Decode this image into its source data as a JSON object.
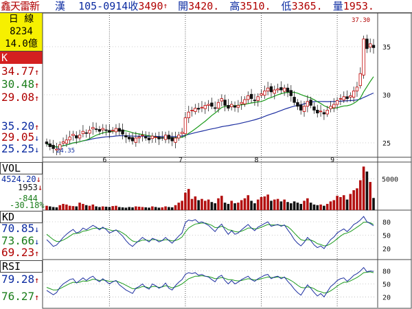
{
  "header": {
    "stock_name": "鑫天雷新",
    "kind": "漢",
    "date": "105-0914",
    "close_label": "收",
    "close_value": "3490",
    "close_arrow": "↑",
    "open_label": "開",
    "open_value": "3420.",
    "high_label": "高",
    "high_value": "3510.",
    "low_label": "低",
    "low_value": "3365.",
    "volume_label": "量",
    "volume_value": "1953."
  },
  "info_box": {
    "period": "日 線",
    "trade_count": "8234",
    "amount": "14.0億"
  },
  "k_panel": {
    "label": "K",
    "ma_values": [
      {
        "value": "34.77",
        "arrow": "↑",
        "color": "#b00000"
      },
      {
        "value": "30.48",
        "arrow": "↑",
        "color": "#1a7d1a"
      },
      {
        "value": "29.08",
        "arrow": "↑",
        "color": "#b00000"
      },
      {
        "value": "35.20",
        "arrow": "↑",
        "color": "#0a2aa0"
      },
      {
        "value": "29.05",
        "arrow": "↓",
        "color": "#b00000"
      },
      {
        "value": "25.25",
        "arrow": "↓",
        "color": "#0a2aa0"
      }
    ],
    "max_label": "37.30",
    "min_label": "24.35",
    "price_ticks": [
      "35",
      "30",
      "25"
    ],
    "month_labels": [
      "6",
      "7",
      "8",
      "9"
    ]
  },
  "vol_panel": {
    "label": "VOL",
    "value1": "4524.20",
    "value1_arrow": "↓",
    "value2": "1953",
    "value2_arrow": "↓",
    "diff": "-844",
    "diff_pct": "-30.18%",
    "tick": "5000"
  },
  "kd_panel": {
    "label": "KD",
    "values": [
      {
        "value": "70.85",
        "arrow": "↓",
        "color": "#0a2aa0"
      },
      {
        "value": "73.66",
        "arrow": "↓",
        "color": "#1a7d1a"
      },
      {
        "value": "69.23",
        "arrow": "↑",
        "color": "#b00000"
      }
    ],
    "ticks": [
      "80",
      "50",
      "20"
    ]
  },
  "rsi_panel": {
    "label": "RSI",
    "values": [
      {
        "value": "79.28",
        "arrow": "↑",
        "color": "#0a2aa0"
      },
      {
        "value": "76.27",
        "arrow": "↑",
        "color": "#1a7d1a"
      }
    ],
    "ticks": [
      "80",
      "50",
      "20"
    ]
  },
  "chart_data": {
    "type": "line",
    "ticks_price": [
      25,
      30,
      35
    ],
    "ylim": [
      23.5,
      38.5
    ],
    "months": [
      "6",
      "7",
      "8",
      "9"
    ],
    "close": [
      24.9,
      24.6,
      24.4,
      24.35,
      24.8,
      25.1,
      25.3,
      25.6,
      25.9,
      25.5,
      25.8,
      26.2,
      26.0,
      26.3,
      26.6,
      26.4,
      26.2,
      26.5,
      26.3,
      26.1,
      26.3,
      26.5,
      26.2,
      25.9,
      25.6,
      25.4,
      25.2,
      25.5,
      25.6,
      25.8,
      25.5,
      25.3,
      25.7,
      25.6,
      25.4,
      25.5,
      25.8,
      25.4,
      25.2,
      25.5,
      25.8,
      26.1,
      27.6,
      28.2,
      28.4,
      28.6,
      28.5,
      28.7,
      28.9,
      29.0,
      28.8,
      28.6,
      29.2,
      29.6,
      28.9,
      28.6,
      29.0,
      28.7,
      28.9,
      29.2,
      29.5,
      29.9,
      29.6,
      29.4,
      29.8,
      30.1,
      30.4,
      30.7,
      30.3,
      30.5,
      30.6,
      30.5,
      30.7,
      30.3,
      29.9,
      29.2,
      28.8,
      28.4,
      28.8,
      29.3,
      28.9,
      28.4,
      28.1,
      28.3,
      28.0,
      28.4,
      28.8,
      29.0,
      29.4,
      29.6,
      29.8,
      29.6,
      29.9,
      30.4,
      30.8,
      32.2,
      35.8,
      34.8,
      35.3,
      34.9
    ],
    "kd_k": [
      40,
      33,
      25,
      28,
      36,
      45,
      52,
      58,
      63,
      55,
      58,
      66,
      62,
      67,
      72,
      68,
      62,
      68,
      63,
      55,
      58,
      62,
      55,
      48,
      38,
      30,
      25,
      32,
      38,
      45,
      40,
      35,
      43,
      40,
      35,
      38,
      45,
      38,
      32,
      40,
      48,
      55,
      78,
      84,
      82,
      85,
      78,
      80,
      76,
      72,
      65,
      58,
      68,
      75,
      62,
      52,
      60,
      52,
      55,
      62,
      68,
      74,
      66,
      60,
      68,
      72,
      76,
      80,
      70,
      72,
      74,
      70,
      73,
      62,
      52,
      40,
      32,
      26,
      34,
      45,
      38,
      28,
      22,
      26,
      20,
      30,
      40,
      46,
      55,
      60,
      64,
      58,
      65,
      74,
      78,
      84,
      92,
      80,
      76,
      71
    ],
    "kd_d": [
      52,
      46,
      40,
      36,
      36,
      39,
      43,
      48,
      53,
      54,
      55,
      59,
      60,
      62,
      65,
      66,
      65,
      66,
      65,
      62,
      60,
      61,
      59,
      55,
      50,
      43,
      37,
      35,
      36,
      39,
      39,
      38,
      40,
      40,
      38,
      38,
      40,
      39,
      37,
      38,
      41,
      46,
      57,
      66,
      71,
      75,
      76,
      77,
      77,
      75,
      72,
      67,
      67,
      70,
      67,
      62,
      61,
      58,
      57,
      59,
      62,
      66,
      66,
      64,
      65,
      68,
      71,
      74,
      73,
      73,
      73,
      72,
      72,
      69,
      63,
      55,
      47,
      40,
      38,
      40,
      39,
      36,
      31,
      29,
      26,
      27,
      31,
      36,
      42,
      48,
      53,
      55,
      58,
      63,
      68,
      73,
      79,
      79,
      78,
      74
    ],
    "rsi_fast": [
      35,
      30,
      25,
      30,
      42,
      50,
      55,
      60,
      62,
      52,
      58,
      64,
      58,
      64,
      68,
      60,
      55,
      62,
      56,
      50,
      55,
      58,
      48,
      42,
      36,
      32,
      28,
      40,
      44,
      50,
      42,
      38,
      50,
      46,
      40,
      44,
      52,
      40,
      36,
      46,
      54,
      60,
      72,
      76,
      74,
      76,
      70,
      72,
      68,
      66,
      60,
      55,
      66,
      70,
      58,
      50,
      58,
      50,
      54,
      60,
      64,
      68,
      60,
      56,
      62,
      66,
      70,
      72,
      62,
      66,
      68,
      62,
      66,
      56,
      48,
      38,
      30,
      24,
      36,
      48,
      40,
      30,
      22,
      28,
      20,
      32,
      44,
      50,
      58,
      62,
      64,
      56,
      62,
      70,
      74,
      80,
      88,
      78,
      80,
      79
    ],
    "rsi_slow": [
      42,
      39,
      36,
      36,
      39,
      43,
      47,
      51,
      54,
      53,
      54,
      57,
      56,
      58,
      61,
      60,
      58,
      59,
      58,
      56,
      56,
      57,
      54,
      51,
      47,
      43,
      39,
      39,
      41,
      44,
      43,
      41,
      44,
      44,
      42,
      43,
      46,
      44,
      41,
      43,
      46,
      50,
      56,
      62,
      65,
      68,
      68,
      69,
      68,
      67,
      65,
      62,
      63,
      65,
      63,
      60,
      60,
      58,
      57,
      58,
      60,
      62,
      61,
      59,
      60,
      62,
      64,
      66,
      65,
      65,
      66,
      65,
      65,
      62,
      58,
      53,
      47,
      42,
      41,
      43,
      42,
      39,
      34,
      32,
      29,
      30,
      34,
      39,
      45,
      50,
      54,
      54,
      57,
      61,
      65,
      70,
      76,
      77,
      78,
      76
    ],
    "volume": [
      700,
      600,
      500,
      450,
      800,
      1000,
      900,
      700,
      650,
      600,
      1200,
      1000,
      800,
      700,
      900,
      600,
      500,
      600,
      550,
      500,
      650,
      700,
      500,
      450,
      400,
      500,
      450,
      600,
      550,
      500,
      450,
      400,
      600,
      500,
      400,
      450,
      600,
      500,
      450,
      800,
      1200,
      1500,
      2800,
      3400,
      1800,
      2200,
      1600,
      1800,
      1500,
      1700,
      1300,
      1100,
      1900,
      2300,
      1200,
      1000,
      1500,
      1100,
      1200,
      1600,
      1900,
      2400,
      1500,
      1100,
      1700,
      2100,
      2200,
      2500,
      1500,
      1700,
      1800,
      1400,
      1700,
      1300,
      1100,
      1400,
      1200,
      1000,
      1500,
      1900,
      1200,
      900,
      800,
      900,
      700,
      1000,
      1400,
      1600,
      2300,
      2100,
      2400,
      1700,
      2600,
      3200,
      3500,
      4800,
      7000,
      6200,
      4524,
      1953
    ]
  }
}
